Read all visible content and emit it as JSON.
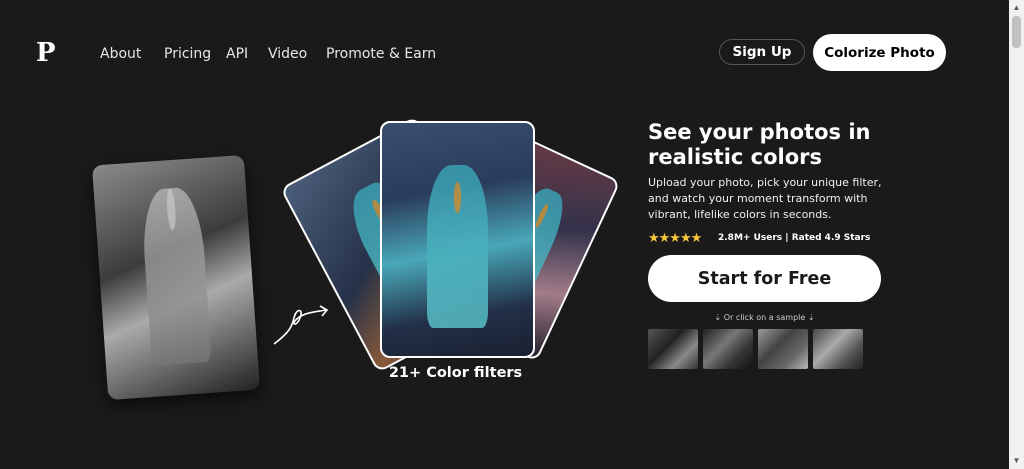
{
  "logo": {
    "text": "P"
  },
  "nav": {
    "items": [
      "About",
      "Pricing",
      "API",
      "Video",
      "Promote & Earn"
    ]
  },
  "header": {
    "signup_label": "Sign Up",
    "colorize_label": "Colorize Photo"
  },
  "hero": {
    "title": "See your photos in realistic colors",
    "description": "Upload your photo, pick your unique filter, and watch your moment transform with vibrant, lifelike colors in seconds.",
    "stars": "★★★★★",
    "rating_text": "2.8M+ Users | Rated 4.9 Stars",
    "cta_label": "Start for Free",
    "sample_note": "⇣ Or click on a sample ⇣",
    "filters_caption": "21+ Color filters"
  },
  "colors": {
    "background": "#1b1a1b",
    "button_bg": "#ffffff",
    "star": "#f6c73d"
  },
  "icons": [
    "arrow-squiggle-icon",
    "star-icon"
  ]
}
